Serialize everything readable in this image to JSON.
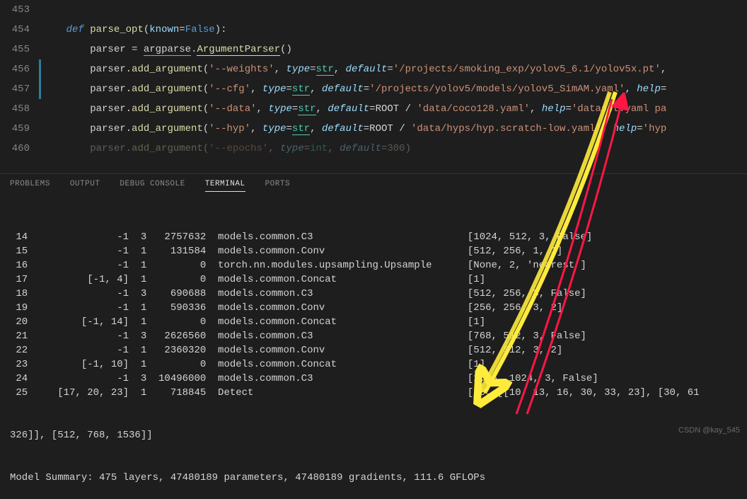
{
  "editor": {
    "lines": [
      {
        "num": "453",
        "html": ""
      },
      {
        "num": "454",
        "html": "    <span class='kw'>def</span> <span class='fn'>parse_opt</span><span class='op'>(</span><span class='param'>known</span><span class='op'>=</span><span class='const'>False</span><span class='op'>):</span>"
      },
      {
        "num": "455",
        "html": "        <span class='ident'>parser</span> <span class='op'>=</span> <span class='ident underline'>argparse</span><span class='op'>.</span><span class='fn underline-y'>ArgumentParser</span><span class='op'>()</span>"
      },
      {
        "num": "456",
        "modified": true,
        "html": "        <span class='ident'>parser</span><span class='op'>.</span><span class='fn'>add_argument</span><span class='op'>(</span><span class='str'>'--weights'</span><span class='op'>, </span><span class='kwarg'>type</span><span class='op'>=</span><span class='type underline'>str</span><span class='op'>, </span><span class='kwarg'>default</span><span class='op'>=</span><span class='str'>'/projects/smoking_exp/yolov5_6.1/yolov5x.pt'</span><span class='op'>,</span>"
      },
      {
        "num": "457",
        "modified": true,
        "html": "        <span class='ident'>parser</span><span class='op'>.</span><span class='fn'>add_argument</span><span class='op'>(</span><span class='str'>'--cfg'</span><span class='op'>, </span><span class='kwarg'>type</span><span class='op'>=</span><span class='type underline'>str</span><span class='op'>, </span><span class='kwarg'>default</span><span class='op'>=</span><span class='str'>'/projects/yolov5/models/yolov5_SimAM.yaml'</span><span class='op'>, </span><span class='kwarg'>help</span><span class='op'>=</span>"
      },
      {
        "num": "458",
        "html": "        <span class='ident'>parser</span><span class='op'>.</span><span class='fn'>add_argument</span><span class='op'>(</span><span class='str'>'--data'</span><span class='op'>, </span><span class='kwarg'>type</span><span class='op'>=</span><span class='type underline'>str</span><span class='op'>, </span><span class='kwarg'>default</span><span class='op'>=</span><span class='ident'>ROOT</span> <span class='op'>/</span> <span class='str'>'data/coco128.yaml'</span><span class='op'>, </span><span class='kwarg'>help</span><span class='op'>=</span><span class='str'>'dataset.yaml pa</span>"
      },
      {
        "num": "459",
        "html": "        <span class='ident'>parser</span><span class='op'>.</span><span class='fn'>add_argument</span><span class='op'>(</span><span class='str'>'--hyp'</span><span class='op'>, </span><span class='kwarg'>type</span><span class='op'>=</span><span class='type underline'>str</span><span class='op'>, </span><span class='kwarg'>default</span><span class='op'>=</span><span class='ident'>ROOT</span> <span class='op'>/</span> <span class='str'>'data/hyps/hyp.scratch-low.yaml'</span><span class='op'>, </span><span class='kwarg'>help</span><span class='op'>=</span><span class='str'>'hyp</span>"
      },
      {
        "num": "460",
        "faded": true,
        "html": "        <span class='ident' style='opacity:.35'>parser</span><span class='op' style='opacity:.35'>.</span><span class='fn' style='opacity:.35'>add_argument</span><span class='op' style='opacity:.35'>(</span><span class='str' style='opacity:.35'>'--epochs'</span><span class='op' style='opacity:.35'>, </span><span class='kwarg' style='opacity:.35'>type</span><span class='op' style='opacity:.35'>=</span><span class='type' style='opacity:.35'>int</span><span class='op' style='opacity:.35'>, </span><span class='kwarg' style='opacity:.35'>default</span><span class='op' style='opacity:.35'>=</span><span style='color:#b5cea8;opacity:.35'>300</span><span class='op' style='opacity:.35'>)</span>"
      }
    ]
  },
  "panel": {
    "tabs": [
      "PROBLEMS",
      "OUTPUT",
      "DEBUG CONSOLE",
      "TERMINAL",
      "PORTS"
    ],
    "active": 3
  },
  "terminal": {
    "rows": [
      {
        "n": "14",
        "a": "-1",
        "b": "3",
        "c": "2757632",
        "d": "models.common.C3",
        "e": "[1024, 512, 3, False]"
      },
      {
        "n": "15",
        "a": "-1",
        "b": "1",
        "c": "131584",
        "d": "models.common.Conv",
        "e": "[512, 256, 1, 1]"
      },
      {
        "n": "16",
        "a": "-1",
        "b": "1",
        "c": "0",
        "d": "torch.nn.modules.upsampling.Upsample",
        "e": "[None, 2, 'nearest']"
      },
      {
        "n": "17",
        "a": "[-1, 4]",
        "b": "1",
        "c": "0",
        "d": "models.common.Concat",
        "e": "[1]"
      },
      {
        "n": "18",
        "a": "-1",
        "b": "3",
        "c": "690688",
        "d": "models.common.C3",
        "e": "[512, 256, 3, False]"
      },
      {
        "n": "19",
        "a": "-1",
        "b": "1",
        "c": "590336",
        "d": "models.common.Conv",
        "e": "[256, 256, 3, 2]"
      },
      {
        "n": "20",
        "a": "[-1, 14]",
        "b": "1",
        "c": "0",
        "d": "models.common.Concat",
        "e": "[1]"
      },
      {
        "n": "21",
        "a": "-1",
        "b": "3",
        "c": "2626560",
        "d": "models.common.C3",
        "e": "[768, 512, 3, False]"
      },
      {
        "n": "22",
        "a": "-1",
        "b": "1",
        "c": "2360320",
        "d": "models.common.Conv",
        "e": "[512, 512, 3, 2]"
      },
      {
        "n": "23",
        "a": "[-1, 10]",
        "b": "1",
        "c": "0",
        "d": "models.common.Concat",
        "e": "[1]"
      },
      {
        "n": "24",
        "a": "-1",
        "b": "3",
        "c": "10496000",
        "d": "models.common.C3",
        "e": "[1536, 1024, 3, False]"
      },
      {
        "n": "25",
        "a": "[17, 20, 23]",
        "b": "1",
        "c": "718845",
        "d": "Detect",
        "e": "[80, [[10, 13, 16, 30, 33, 23], [30, 61"
      }
    ],
    "wrap": "326]], [512, 768, 1536]]",
    "summary": "Model Summary: 475 layers, 47480189 parameters, 47480189 gradients, 111.6 GFLOPs"
  },
  "watermark": "CSDN @kay_545"
}
